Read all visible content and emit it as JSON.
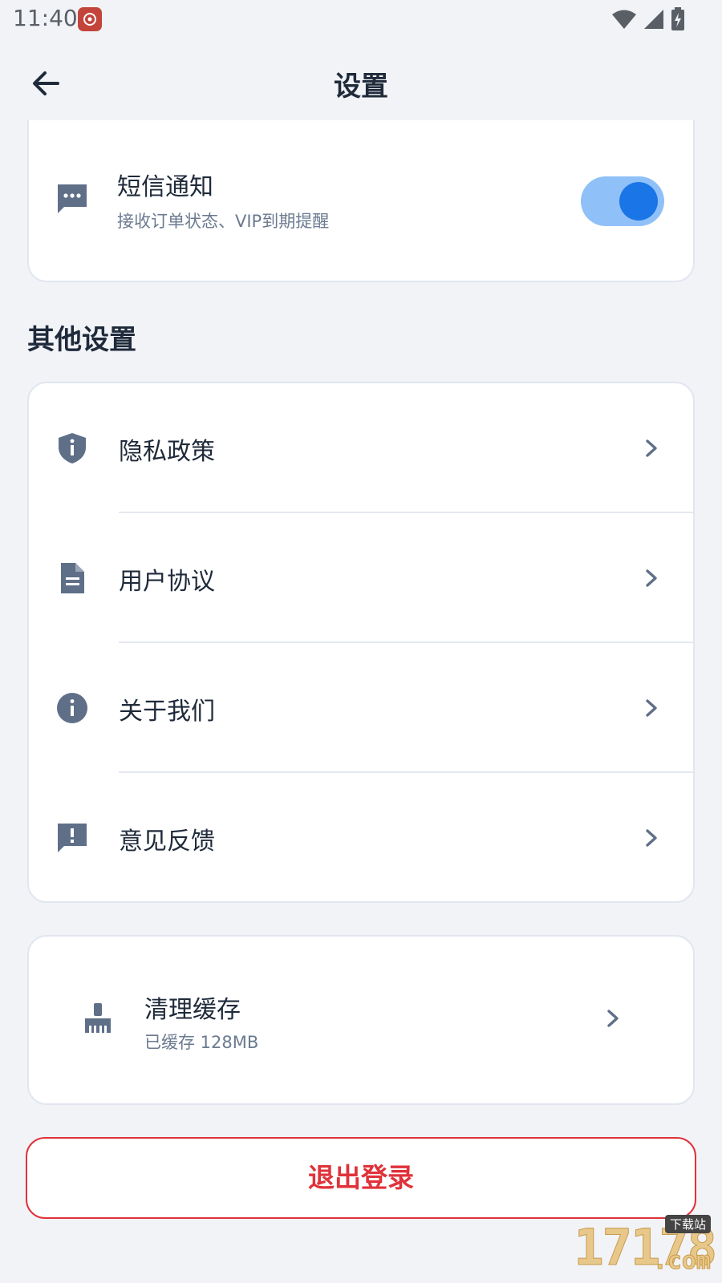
{
  "status_bar": {
    "time": "11:40"
  },
  "app_bar": {
    "title": "设置"
  },
  "sms": {
    "title": "短信通知",
    "subtitle": "接收订单状态、VIP到期提醒",
    "enabled": true
  },
  "section": {
    "heading": "其他设置"
  },
  "other_items": [
    {
      "label": "隐私政策",
      "icon": "shield-info-icon"
    },
    {
      "label": "用户协议",
      "icon": "document-icon"
    },
    {
      "label": "关于我们",
      "icon": "info-icon"
    },
    {
      "label": "意见反馈",
      "icon": "feedback-icon"
    }
  ],
  "cache": {
    "title": "清理缓存",
    "subtitle": "已缓存 128MB",
    "icon": "broom-icon"
  },
  "logout": {
    "label": "退出登录"
  },
  "watermark": {
    "number": "17178",
    "tag": "下载站",
    "suffix": ".com"
  },
  "colors": {
    "accent": "#1a75e6",
    "toggle_track": "#8fc0f8",
    "danger": "#e0323a",
    "icon": "#5f6f88"
  }
}
